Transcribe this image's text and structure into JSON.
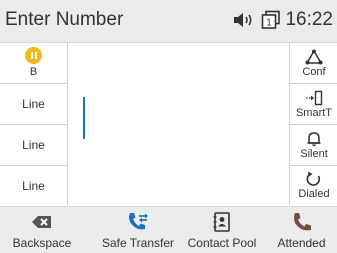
{
  "header": {
    "title": "Enter Number",
    "time": "16:22",
    "line_indicator": "1"
  },
  "left_keys": [
    {
      "label": "B",
      "status": "hold",
      "icon": "hold-icon"
    },
    {
      "label": "Line"
    },
    {
      "label": "Line"
    },
    {
      "label": "Line"
    }
  ],
  "right_keys": [
    {
      "label": "Conf",
      "icon": "conference-icon"
    },
    {
      "label": "SmartT",
      "icon": "smart-transfer-icon"
    },
    {
      "label": "Silent",
      "icon": "bell-icon"
    },
    {
      "label": "Dialed",
      "icon": "redial-icon"
    }
  ],
  "softkeys": [
    {
      "label": "Backspace",
      "icon": "backspace-icon"
    },
    {
      "label": "Safe Transfer",
      "icon": "transfer-phone-icon"
    },
    {
      "label": "Contact Pool",
      "icon": "contact-book-icon"
    },
    {
      "label": "Attended",
      "icon": "phone-icon"
    }
  ],
  "colors": {
    "accent": "#1a6fc4",
    "hold": "#f4b81c",
    "bar_bg": "#ebebeb"
  }
}
